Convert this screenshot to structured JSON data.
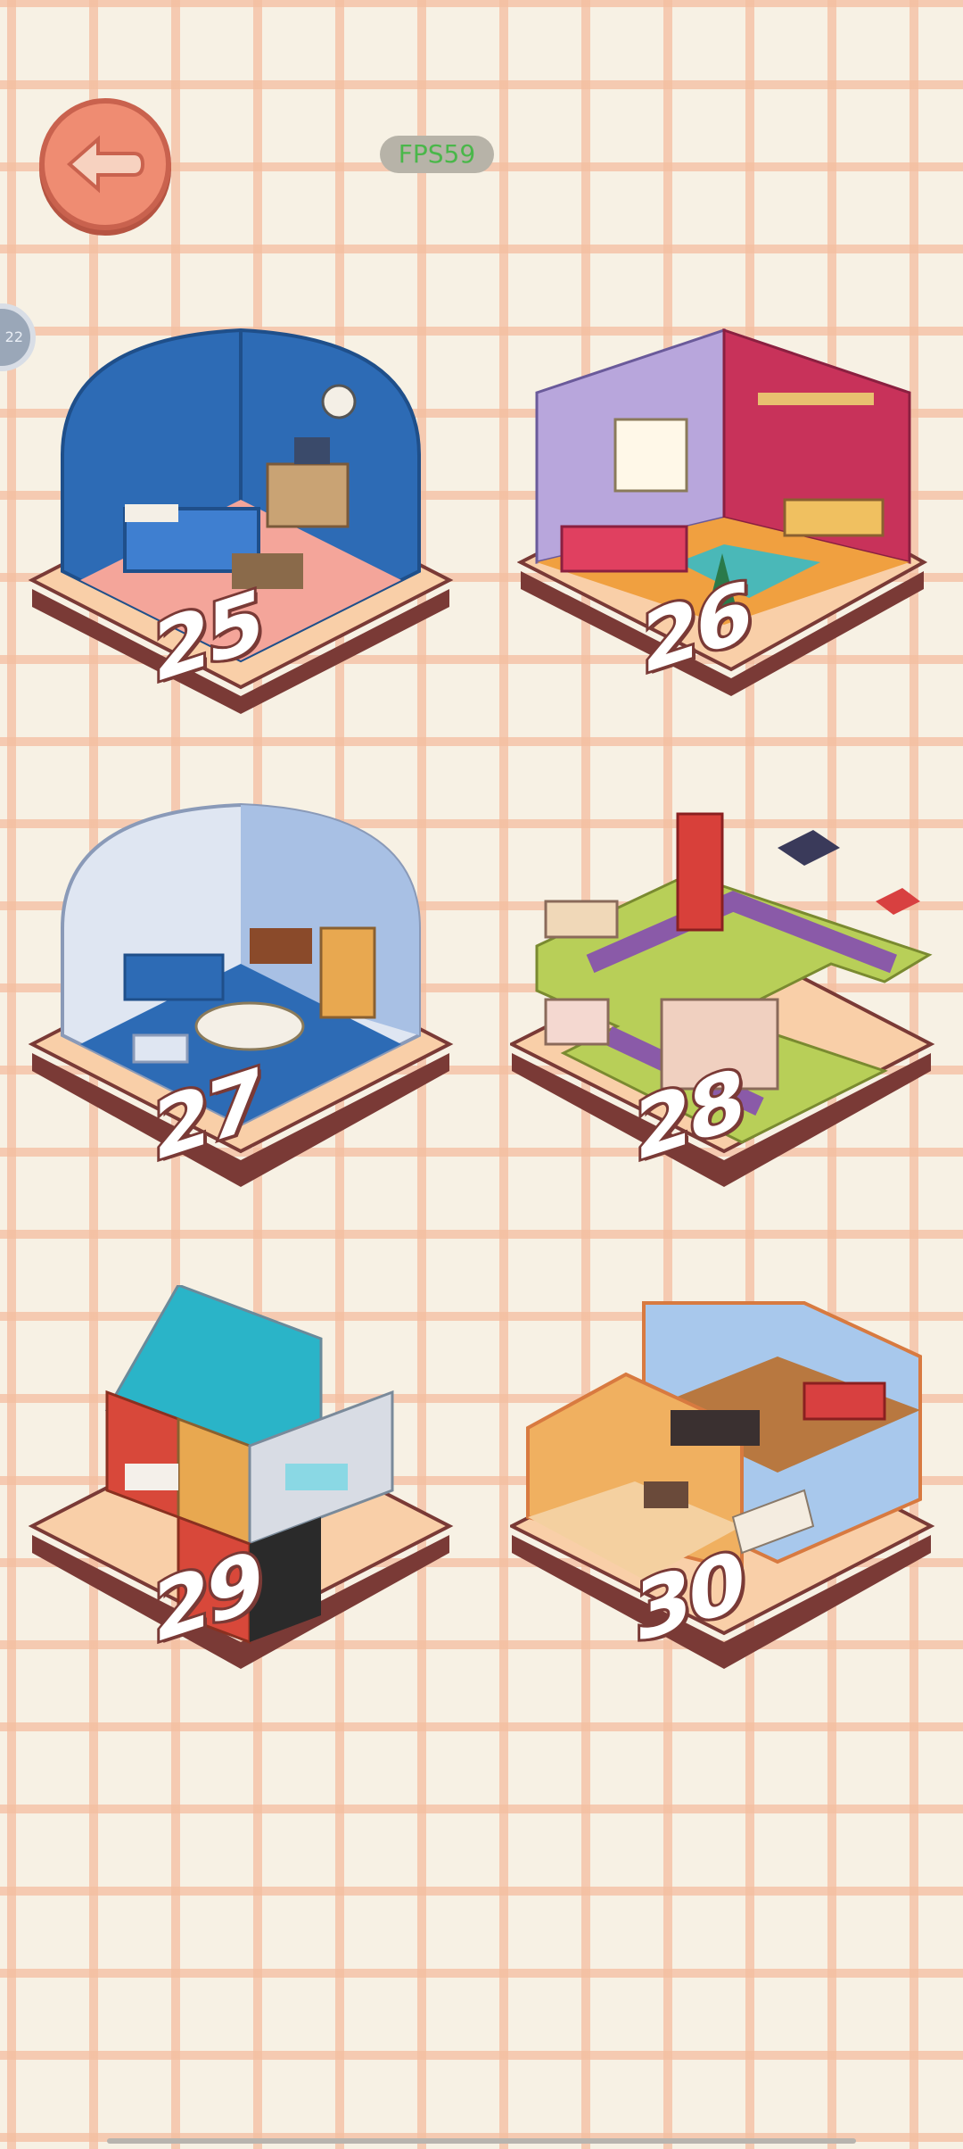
{
  "status": {
    "fps_label": "FPS59"
  },
  "side_badge": {
    "label": "22"
  },
  "levels": [
    {
      "number": "25",
      "theme": "blue bedroom"
    },
    {
      "number": "26",
      "theme": "pink and lavender bedroom"
    },
    {
      "number": "27",
      "theme": "blue living room"
    },
    {
      "number": "28",
      "theme": "city block"
    },
    {
      "number": "29",
      "theme": "multi-room house"
    },
    {
      "number": "30",
      "theme": "two-floor apartment"
    }
  ],
  "colors": {
    "background": "#f7f1e4",
    "grid": "#f4bea0",
    "base_top": "#f9cfa8",
    "base_side": "#7a3a36",
    "back_button": "#ef8c72"
  }
}
